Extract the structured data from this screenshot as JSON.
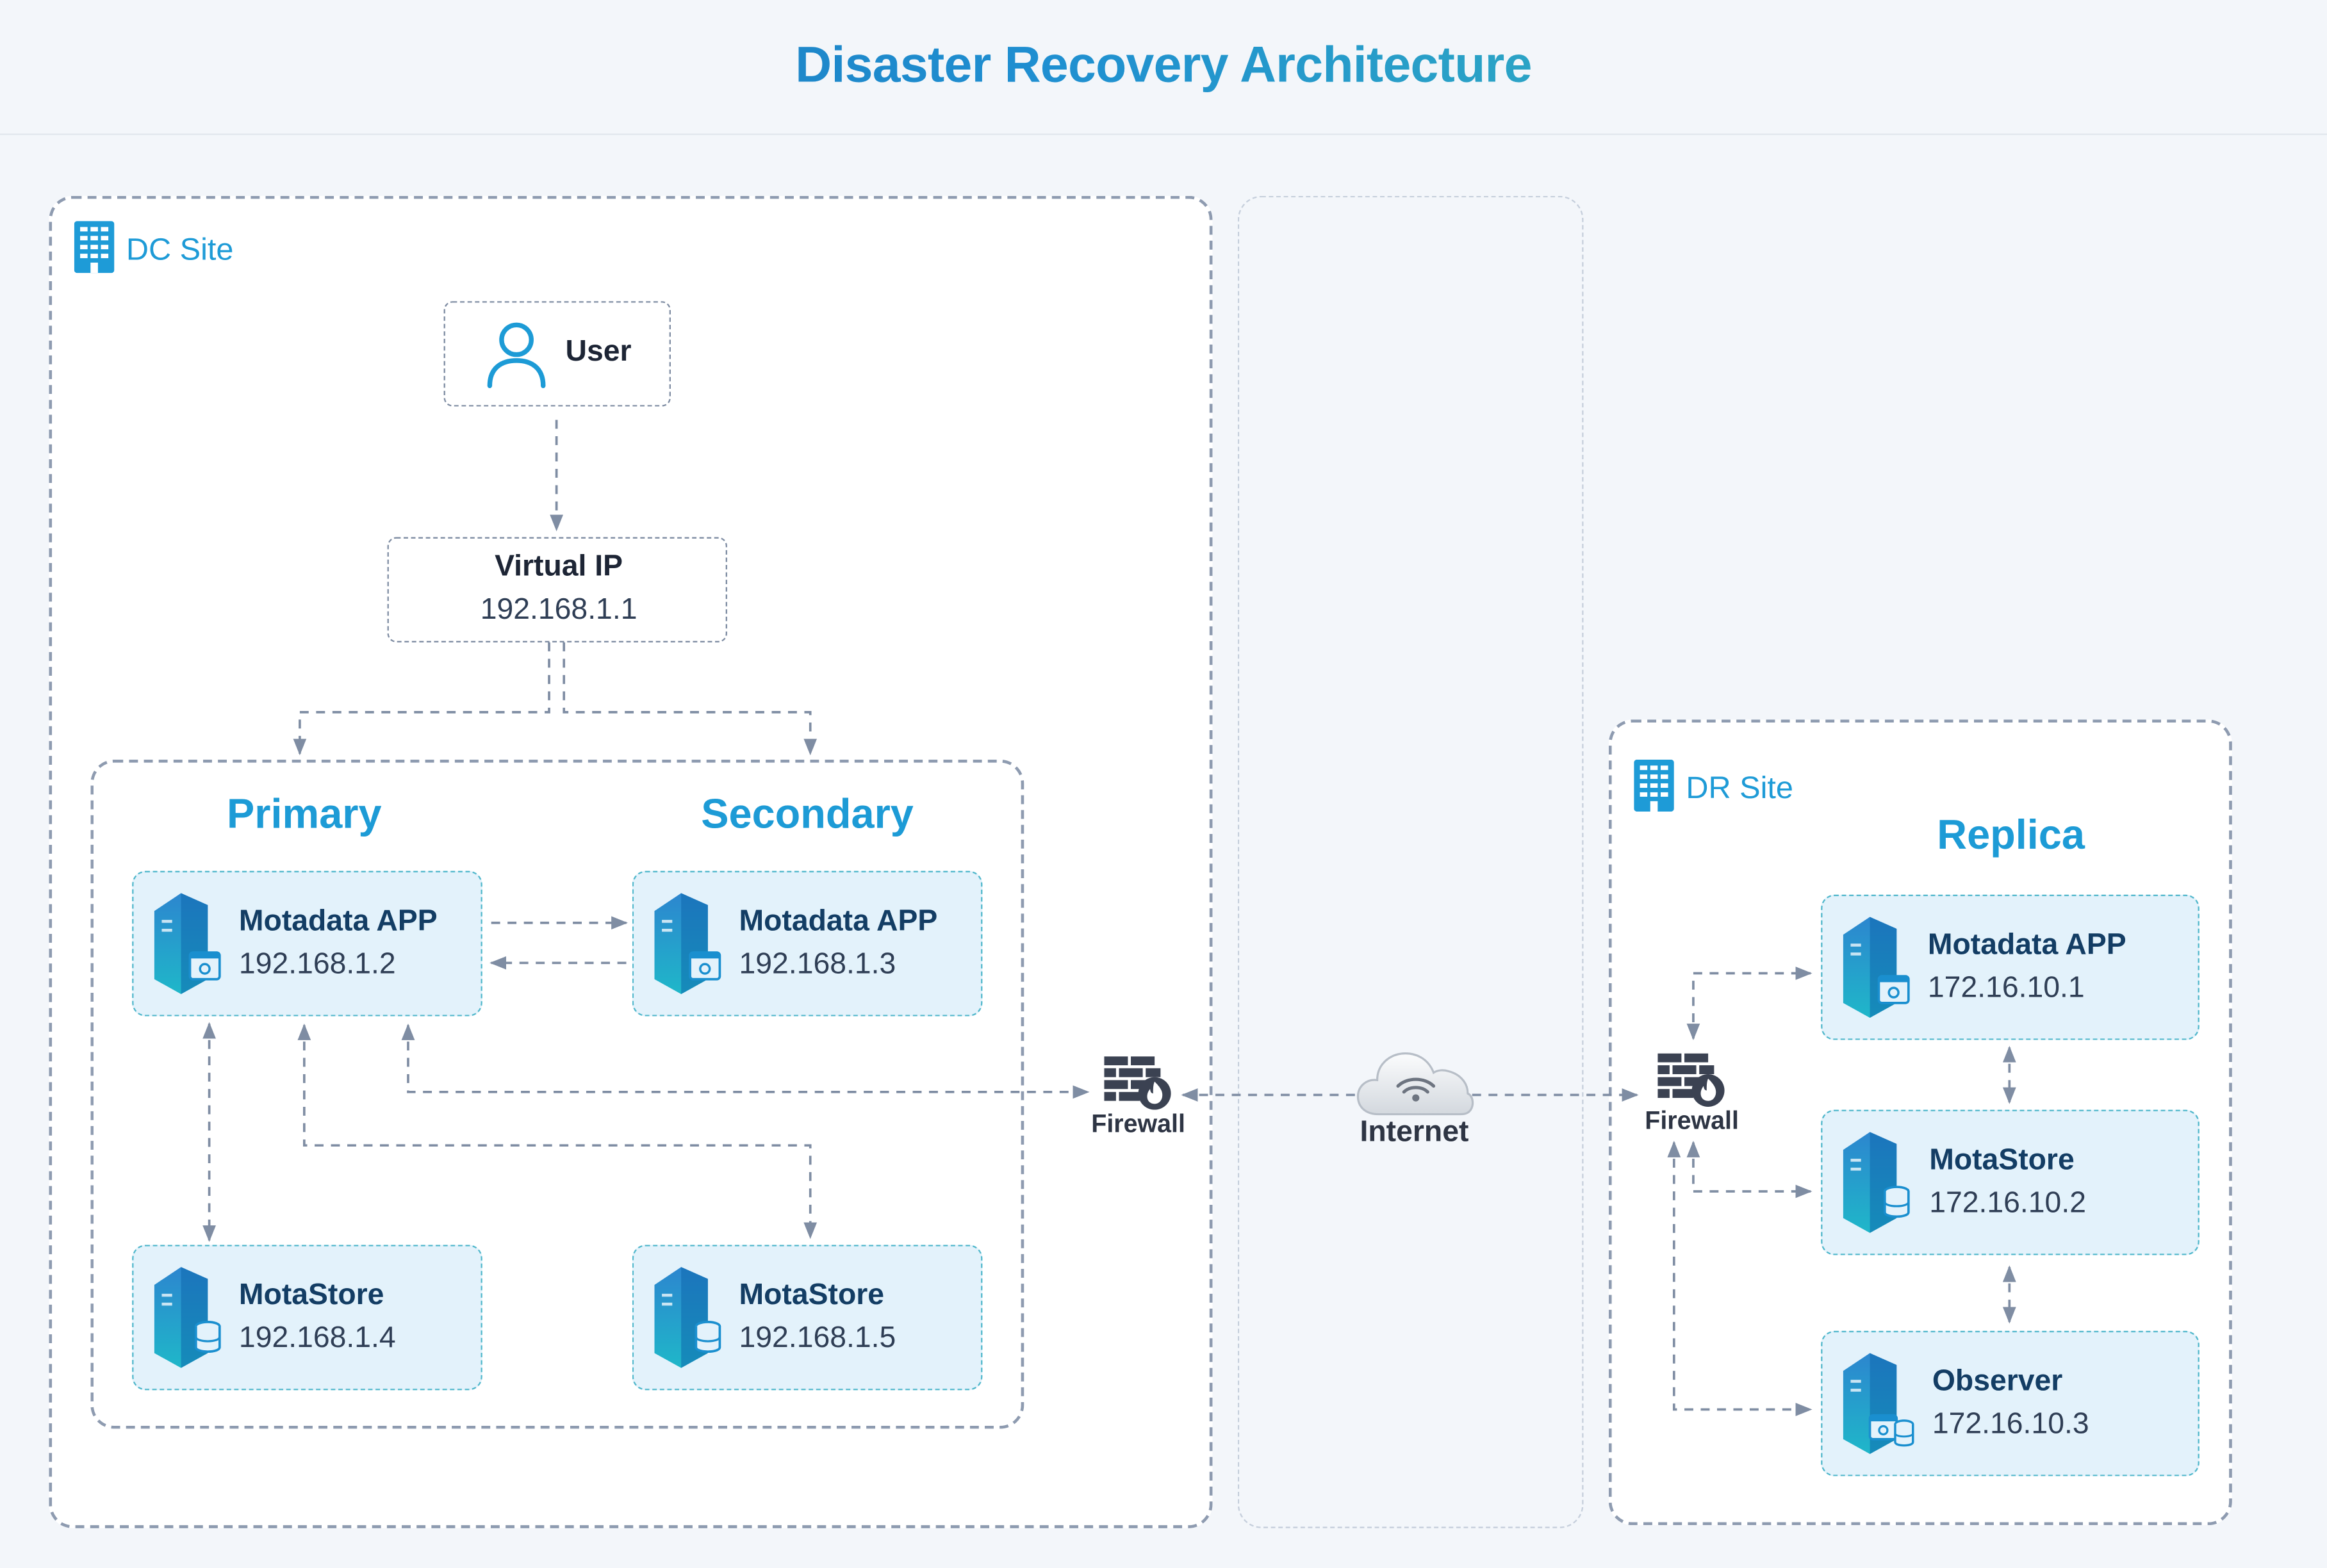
{
  "title": "Disaster Recovery Architecture",
  "dc_site": {
    "label": "DC Site",
    "user": {
      "label": "User"
    },
    "virtual_ip": {
      "label": "Virtual IP",
      "ip": "192.168.1.1"
    },
    "primary": {
      "heading": "Primary",
      "app": {
        "name": "Motadata APP",
        "ip": "192.168.1.2"
      },
      "store": {
        "name": "MotaStore",
        "ip": "192.168.1.4"
      }
    },
    "secondary": {
      "heading": "Secondary",
      "app": {
        "name": "Motadata APP",
        "ip": "192.168.1.3"
      },
      "store": {
        "name": "MotaStore",
        "ip": "192.168.1.5"
      }
    },
    "firewall": {
      "label": "Firewall"
    }
  },
  "internet": {
    "label": "Internet"
  },
  "dr_site": {
    "label": "DR Site",
    "heading": "Replica",
    "firewall": {
      "label": "Firewall"
    },
    "app": {
      "name": "Motadata APP",
      "ip": "172.16.10.1"
    },
    "store": {
      "name": "MotaStore",
      "ip": "172.16.10.2"
    },
    "observer": {
      "name": "Observer",
      "ip": "172.16.10.3"
    }
  },
  "colors": {
    "accent": "#1d9bd6",
    "card_fill": "#e3f2fb",
    "card_border": "#52b8cc",
    "connector": "#7f8da3"
  }
}
